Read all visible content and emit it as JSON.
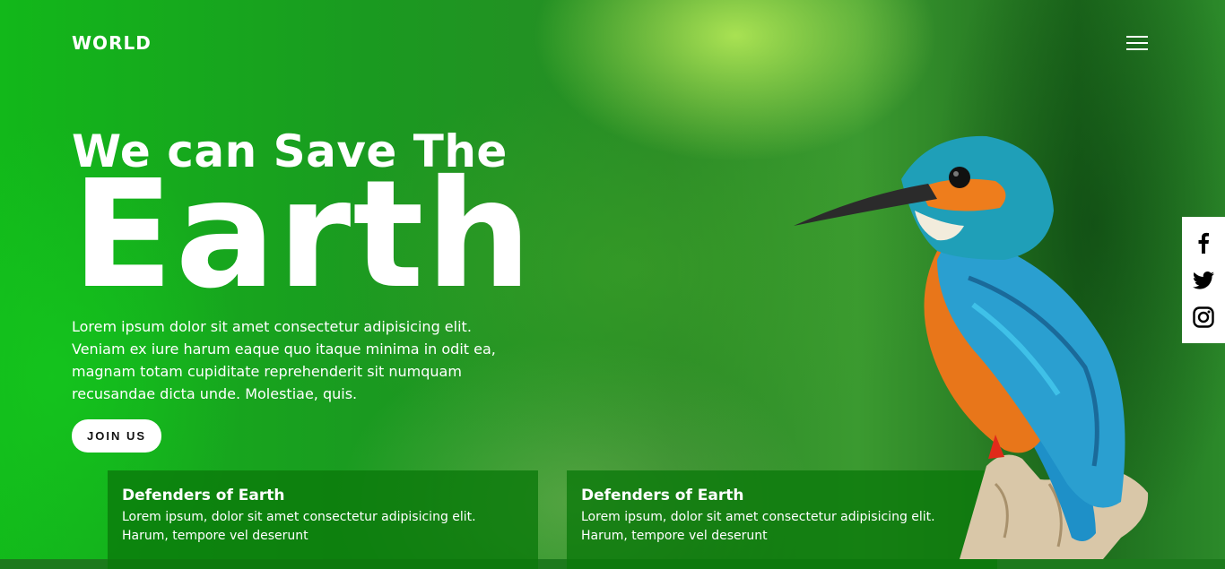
{
  "brand": {
    "logo": "WORLD"
  },
  "header": {
    "menu_icon": "hamburger-menu-icon"
  },
  "hero": {
    "title_line1": "We can Save The",
    "title_line2": "Earth",
    "description": "Lorem ipsum dolor sit amet consectetur adipisicing elit. Veniam ex iure harum eaque quo itaque minima in odit ea, magnam totam cupiditate reprehenderit sit numquam recusandae dicta unde. Molestiae, quis.",
    "cta_label": "JOIN US"
  },
  "cards": [
    {
      "title": "Defenders of Earth",
      "text": "Lorem ipsum, dolor sit amet consectetur adipisicing elit. Harum, tempore vel deserunt"
    },
    {
      "title": "Defenders of Earth",
      "text": "Lorem ipsum, dolor sit amet consectetur adipisicing elit. Harum, tempore vel deserunt"
    }
  ],
  "social": [
    "facebook-icon",
    "twitter-icon",
    "instagram-icon"
  ],
  "colors": {
    "text": "#ffffff",
    "card_bg": "#0a780a",
    "accent_green": "#12b81a"
  }
}
